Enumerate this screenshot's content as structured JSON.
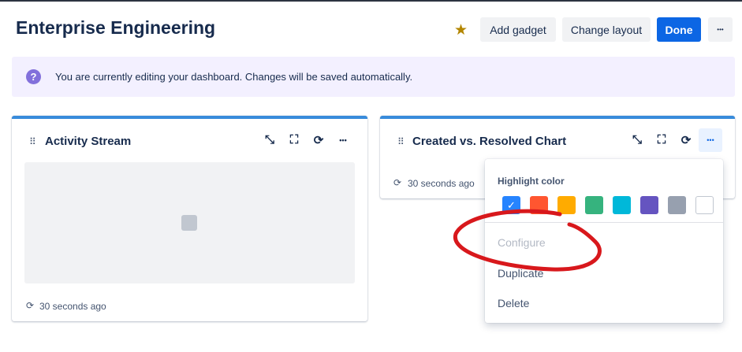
{
  "header": {
    "title": "Enterprise Engineering",
    "add_gadget": "Add gadget",
    "change_layout": "Change layout",
    "done": "Done",
    "more": "•••"
  },
  "banner": {
    "text": "You are currently editing your dashboard. Changes will be saved automatically."
  },
  "gadgets": [
    {
      "title": "Activity Stream",
      "updated": "30 seconds ago"
    },
    {
      "title": "Created vs. Resolved Chart",
      "updated": "30 seconds ago"
    }
  ],
  "menu": {
    "highlight_label": "Highlight color",
    "colors": [
      "#2684ff",
      "#ff5630",
      "#ffab00",
      "#36b37e",
      "#00b8d9",
      "#6554c0",
      "#97a0af",
      "#ffffff"
    ],
    "selected_color": "#2684ff",
    "items": [
      "Configure",
      "Duplicate",
      "Delete"
    ]
  },
  "annotation_color": "#d8181c"
}
